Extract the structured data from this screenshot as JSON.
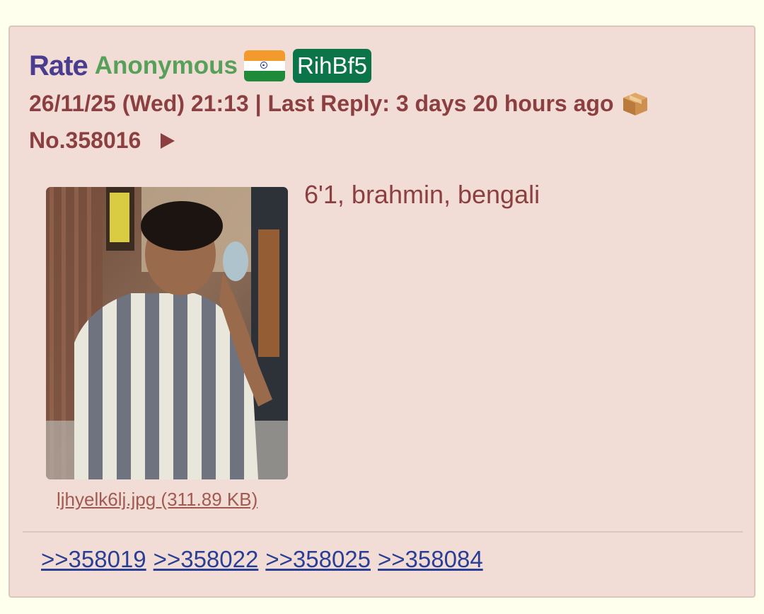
{
  "post": {
    "subject": "Rate",
    "name": "Anonymous",
    "flag_icon": "india-flag-icon",
    "poster_id": "RihBf5",
    "meta": "26/11/25 (Wed) 21:13 | Last Reply: 3 days 20 hours ago",
    "post_number": "No.358016",
    "file": {
      "label": "ljhyelk6lj.jpg (311.89 KB)"
    },
    "message": "6'1, brahmin, bengali",
    "replies": [
      ">>358019",
      ">>358022",
      ">>358025",
      ">>358084"
    ]
  },
  "colors": {
    "page_background": "#ffffee",
    "post_background": "#f2ddd6",
    "subject": "#4a3d8f",
    "name": "#58a05a",
    "id_badge": "#0b7448",
    "meta_text": "#8c3f40",
    "link": "#2a3f94"
  }
}
